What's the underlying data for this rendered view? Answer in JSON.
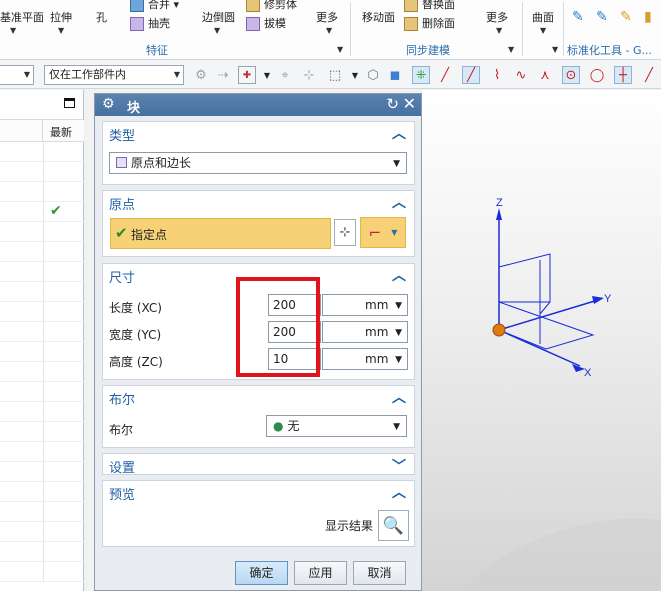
{
  "ribbon": {
    "datum_plane": "基准平面",
    "extrude": "拉伸",
    "hole": "孔",
    "unite": "合并",
    "shell": "抽壳",
    "edge_blend": "边倒圆",
    "draft": "拔模",
    "more1": "更多",
    "trim_body": "修剪体",
    "move_face": "移动面",
    "replace_face": "替换面",
    "delete_face": "删除面",
    "more2": "更多",
    "surface": "曲面",
    "group_feature": "特征",
    "group_sync": "同步建模",
    "group_std": "标准化工具 - G..."
  },
  "toolbar": {
    "scope_value": "仅在工作部件内"
  },
  "navigator": {
    "col_latest": "最新",
    "row_count": 22
  },
  "dialog": {
    "title": "块",
    "type_section": "类型",
    "type_value": "原点和边长",
    "origin_section": "原点",
    "specify_point": "指定点",
    "dim_section": "尺寸",
    "length_label": "长度 (XC)",
    "length_value": "200",
    "width_label": "宽度 (YC)",
    "width_value": "200",
    "height_label": "高度 (ZC)",
    "height_value": "10",
    "unit": "mm",
    "bool_section": "布尔",
    "bool_label": "布尔",
    "bool_value": "无",
    "settings_section": "设置",
    "preview_section": "预览",
    "show_result": "显示结果",
    "ok": "确定",
    "apply": "应用",
    "cancel": "取消"
  },
  "viewport": {
    "axis_x": "X",
    "axis_y": "Y",
    "axis_z": "Z",
    "axis_color": "#1a2bd8",
    "origin_color": "#e07a12"
  },
  "colors": {
    "highlight_box": "#e0141c",
    "selection_yellow": "#f6d176",
    "section_title": "#1f5fa6"
  }
}
